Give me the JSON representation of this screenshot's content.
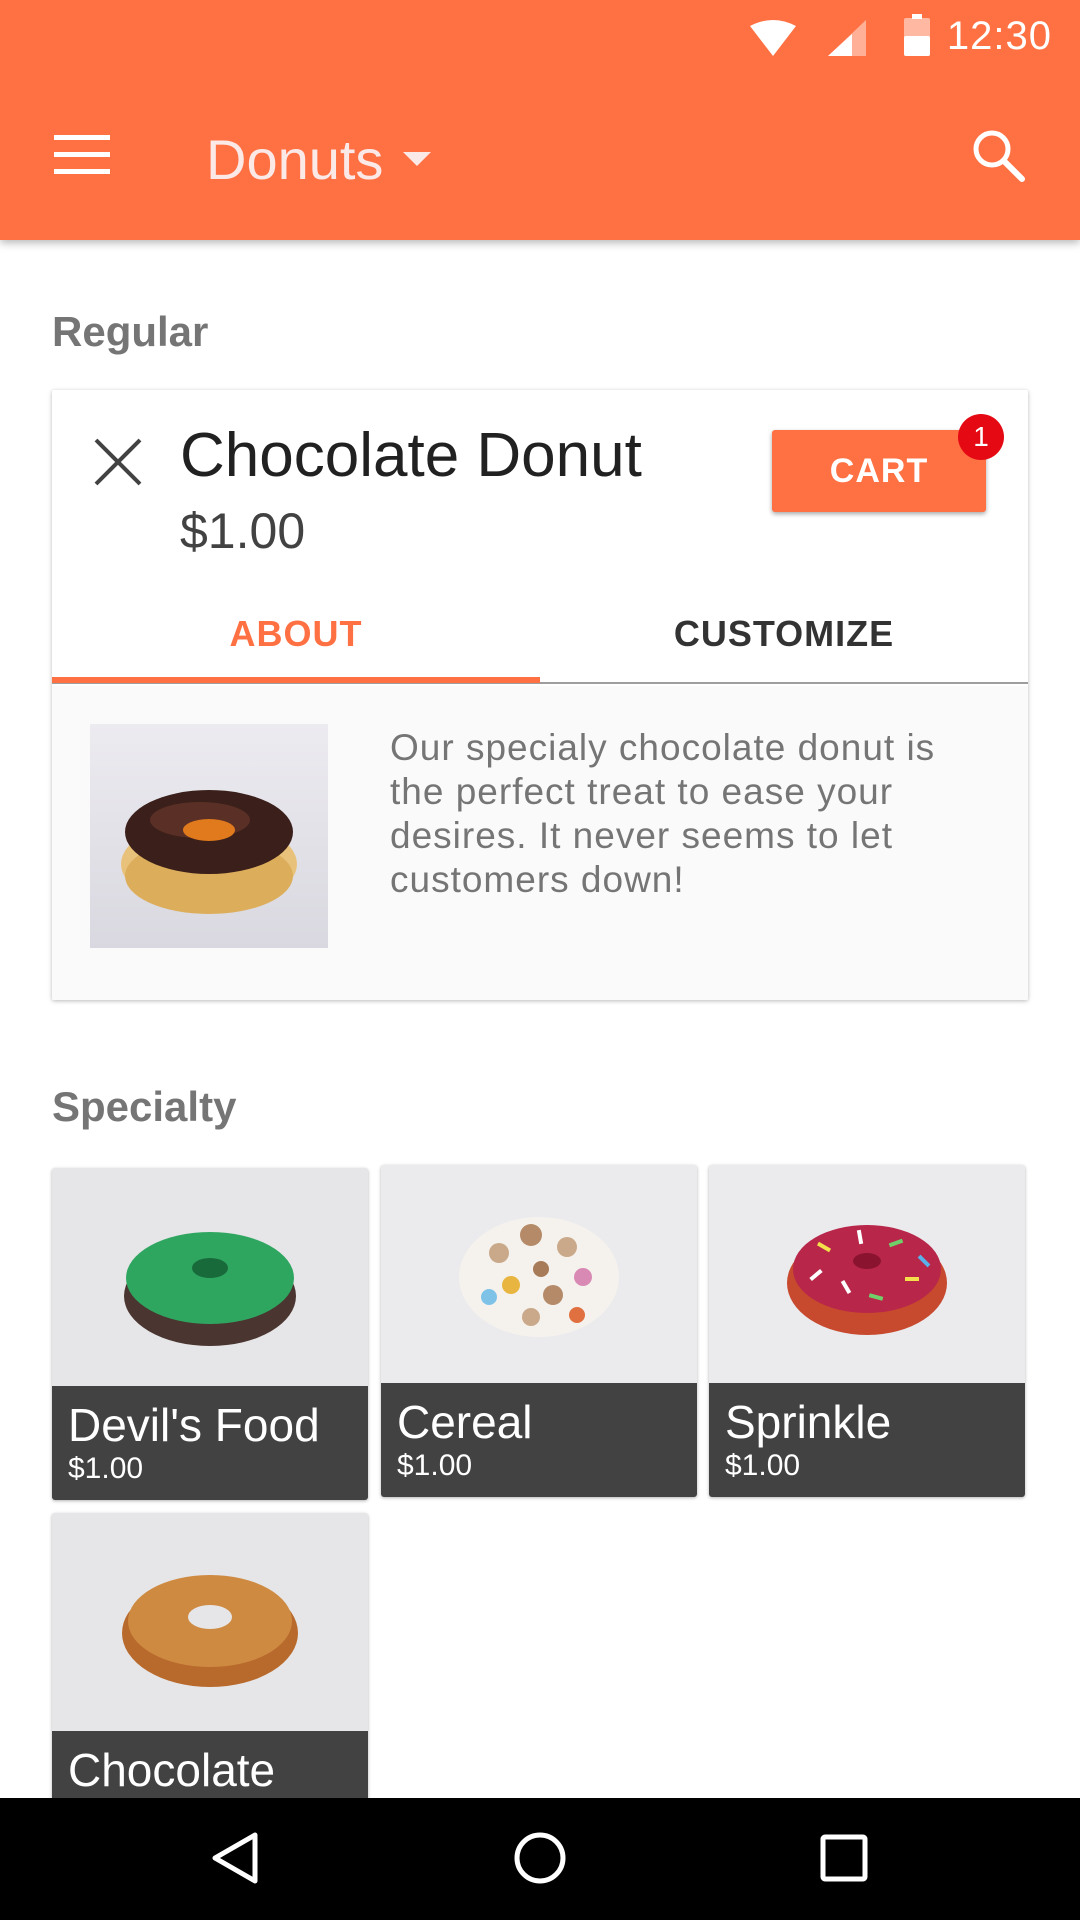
{
  "status_bar": {
    "time": "12:30",
    "icons": [
      "wifi-icon",
      "cell-signal-icon",
      "battery-icon"
    ]
  },
  "toolbar": {
    "title": "Donuts",
    "menu_icon": "menu-icon",
    "dropdown_icon": "dropdown-arrow-icon",
    "search_icon": "search-icon"
  },
  "colors": {
    "primary": "#ff7043",
    "badge": "#e50914",
    "tile_footer": "#424242"
  },
  "regular": {
    "title": "Regular",
    "detail": {
      "name": "Chocolate Donut",
      "price": "$1.00",
      "cart_label": "CART",
      "cart_count": "1",
      "tabs": [
        {
          "label": "ABOUT",
          "selected": true
        },
        {
          "label": "CUSTOMIZE",
          "selected": false
        }
      ],
      "description": "Our specialy chocolate donut is the perfect treat to ease your desires. It never seems to let customers down!"
    }
  },
  "specialty": {
    "title": "Specialty",
    "items": [
      {
        "name": "Devil's Food",
        "price": "$1.00"
      },
      {
        "name": "Cereal",
        "price": "$1.00"
      },
      {
        "name": "Sprinkle",
        "price": "$1.00"
      },
      {
        "name": "Chocolate",
        "price": ""
      }
    ]
  },
  "nav_bar": {
    "icons": [
      "back-icon",
      "home-icon",
      "recents-icon"
    ]
  }
}
